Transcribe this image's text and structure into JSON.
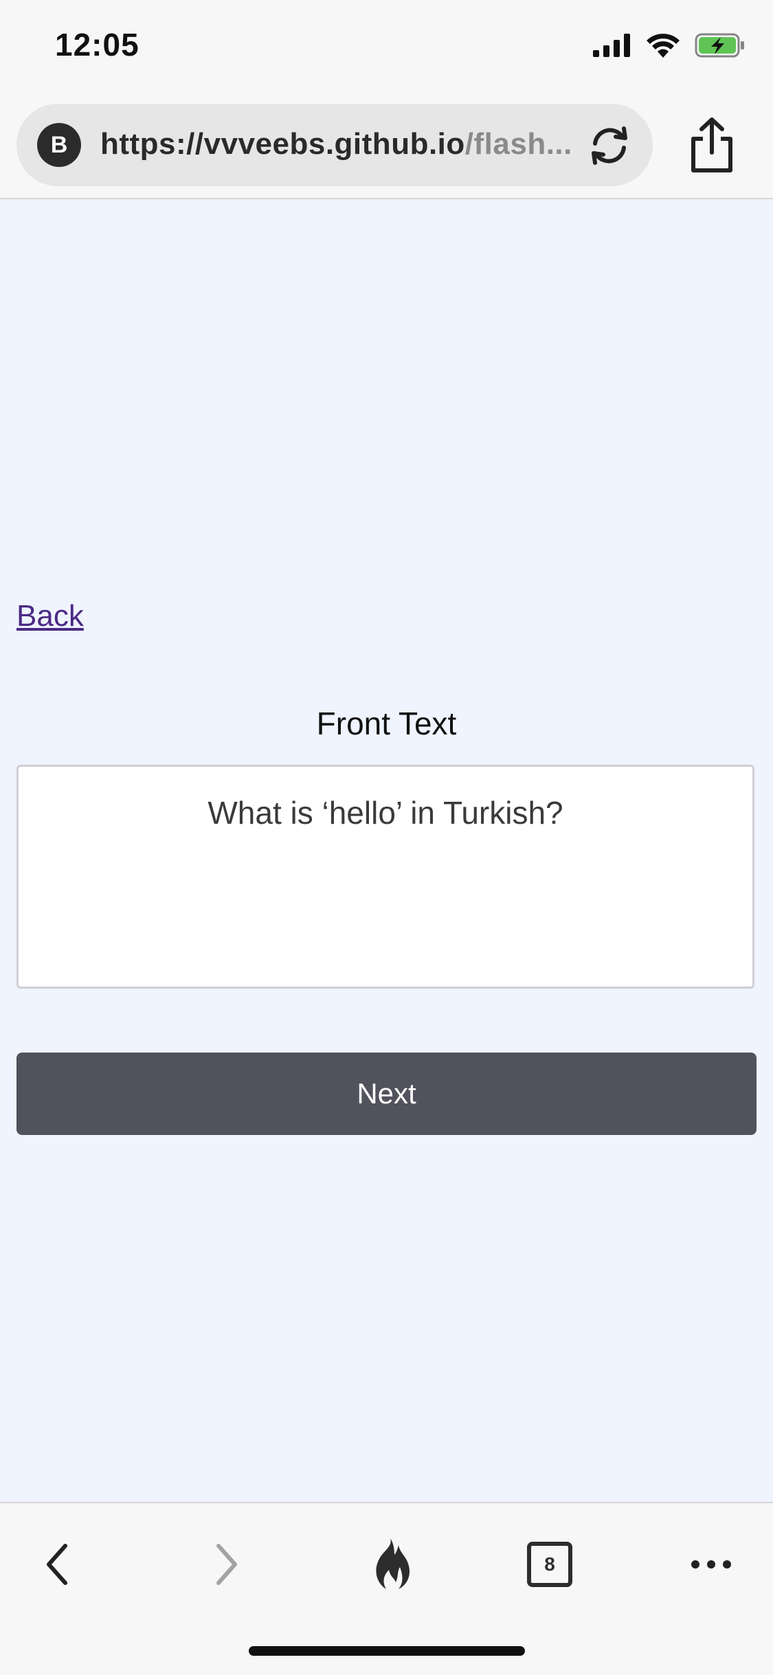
{
  "status_bar": {
    "time": "12:05",
    "icons": [
      "signal-icon",
      "wifi-icon",
      "battery-charging-icon"
    ],
    "battery_color": "#5fc455"
  },
  "browser": {
    "site_initial": "B",
    "url_main": "https://vvveebs.github.io",
    "url_dim": "/flash...",
    "reload_icon": "reload-icon",
    "share_icon": "share-icon"
  },
  "page": {
    "back_label": "Back",
    "field_label": "Front Text",
    "front_text_value": "What is ‘hello’ in Turkish?",
    "next_label": "Next",
    "link_color": "#4b2a85",
    "button_color": "#51525c",
    "background_color": "#eff4fe"
  },
  "toolbar": {
    "items": [
      "back-icon",
      "forward-icon",
      "flame-icon",
      "tabs-icon",
      "more-icon"
    ],
    "tab_count": "8"
  }
}
